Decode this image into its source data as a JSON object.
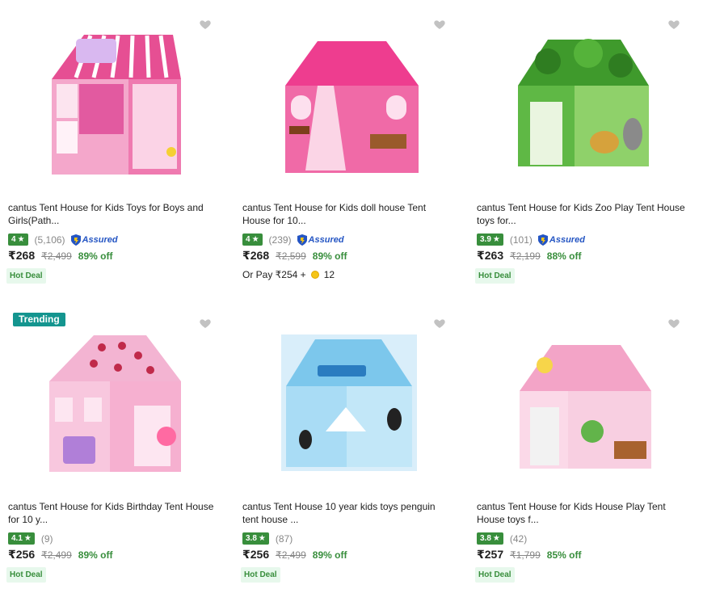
{
  "products": [
    {
      "title": "cantus Tent House for Kids Toys for Boys and Girls(Path...",
      "rating": "4",
      "reviews": "(5,106)",
      "assured": "Assured",
      "price": "₹268",
      "mrp": "₹2,499",
      "off": "89% off",
      "hot_deal": "Hot Deal",
      "image_icon": "kids-zone-tent-image"
    },
    {
      "title": "cantus Tent House for Kids doll house Tent House for 10...",
      "rating": "4",
      "reviews": "(239)",
      "assured": "Assured",
      "price": "₹268",
      "mrp": "₹2,599",
      "off": "89% off",
      "or_pay": "Or Pay ₹254 +",
      "coins": "12",
      "image_icon": "doll-house-tent-image"
    },
    {
      "title": "cantus Tent House for Kids Zoo Play Tent House toys for...",
      "rating": "3.9",
      "reviews": "(101)",
      "assured": "Assured",
      "price": "₹263",
      "mrp": "₹2,199",
      "off": "88% off",
      "hot_deal": "Hot Deal",
      "image_icon": "zoo-tent-image"
    },
    {
      "badge": "Trending",
      "title": "cantus Tent House for Kids Birthday Tent House for 10 y...",
      "rating": "4.1",
      "reviews": "(9)",
      "price": "₹256",
      "mrp": "₹2,499",
      "off": "89% off",
      "hot_deal": "Hot Deal",
      "image_icon": "birthday-tent-image"
    },
    {
      "title": "cantus Tent House 10 year kids toys penguin tent house ...",
      "rating": "3.8",
      "reviews": "(87)",
      "price": "₹256",
      "mrp": "₹2,499",
      "off": "89% off",
      "hot_deal": "Hot Deal",
      "image_icon": "penguin-tent-image"
    },
    {
      "title": "cantus Tent House for Kids House Play Tent House toys f...",
      "rating": "3.8",
      "reviews": "(42)",
      "price": "₹257",
      "mrp": "₹1,799",
      "off": "85% off",
      "hot_deal": "Hot Deal",
      "image_icon": "house-play-tent-image"
    }
  ],
  "colors": {
    "rating_green": "#388e3c",
    "assured_blue": "#2455c3",
    "trending_teal": "#14958f",
    "heart_gray": "#c2c2c2"
  }
}
